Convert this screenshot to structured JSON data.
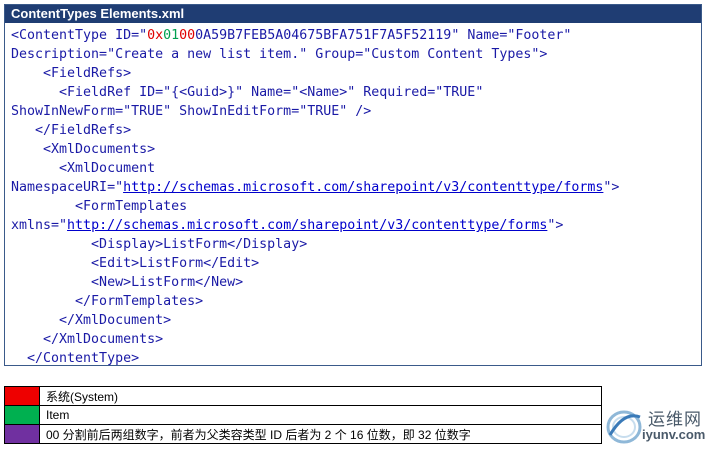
{
  "title": "ContentTypes Elements.xml",
  "code": {
    "l1": {
      "a": "<ContentType ID=\"",
      "r1": "0x",
      "g": "01",
      "r2": "00",
      "b": "0A59B7FEB5A04675BFA751F7A5F52119\" Name=\"Footer\""
    },
    "l2": "Description=\"Create a new list item.\" Group=\"Custom Content Types\">",
    "l3": "    <FieldRefs>",
    "l4": "      <FieldRef ID=\"{<Guid>}\" Name=\"<Name>\" Required=\"TRUE\"",
    "l5": "ShowInNewForm=\"TRUE\" ShowInEditForm=\"TRUE\" />",
    "l6": "   </FieldRefs>",
    "l7": "    <XmlDocuments>",
    "l8": "      <XmlDocument",
    "l9": {
      "a": "NamespaceURI=\"",
      "url": "http://schemas.microsoft.com/sharepoint/v3/contenttype/forms",
      "b": "\">"
    },
    "l10": "        <FormTemplates",
    "l11": {
      "a": "xmlns=\"",
      "url": "http://schemas.microsoft.com/sharepoint/v3/contenttype/forms",
      "b": "\">"
    },
    "l12": "          <Display>ListForm</Display>",
    "l13": "          <Edit>ListForm</Edit>",
    "l14": "          <New>ListForm</New>",
    "l15": "        </FormTemplates>",
    "l16": "      </XmlDocument>",
    "l17": "    </XmlDocuments>",
    "l18": "  </ContentType>"
  },
  "legend": [
    {
      "color": "#ee0000",
      "label": "系统(System)"
    },
    {
      "color": "#00b050",
      "label": "Item"
    },
    {
      "color": "#7030a0",
      "label": "00 分割前后两组数字，前者为父类容类型 ID 后者为 2 个 16 位数，即 32 位数字"
    }
  ],
  "watermark": {
    "cn": "运维网",
    "en": "iyunv.com"
  }
}
